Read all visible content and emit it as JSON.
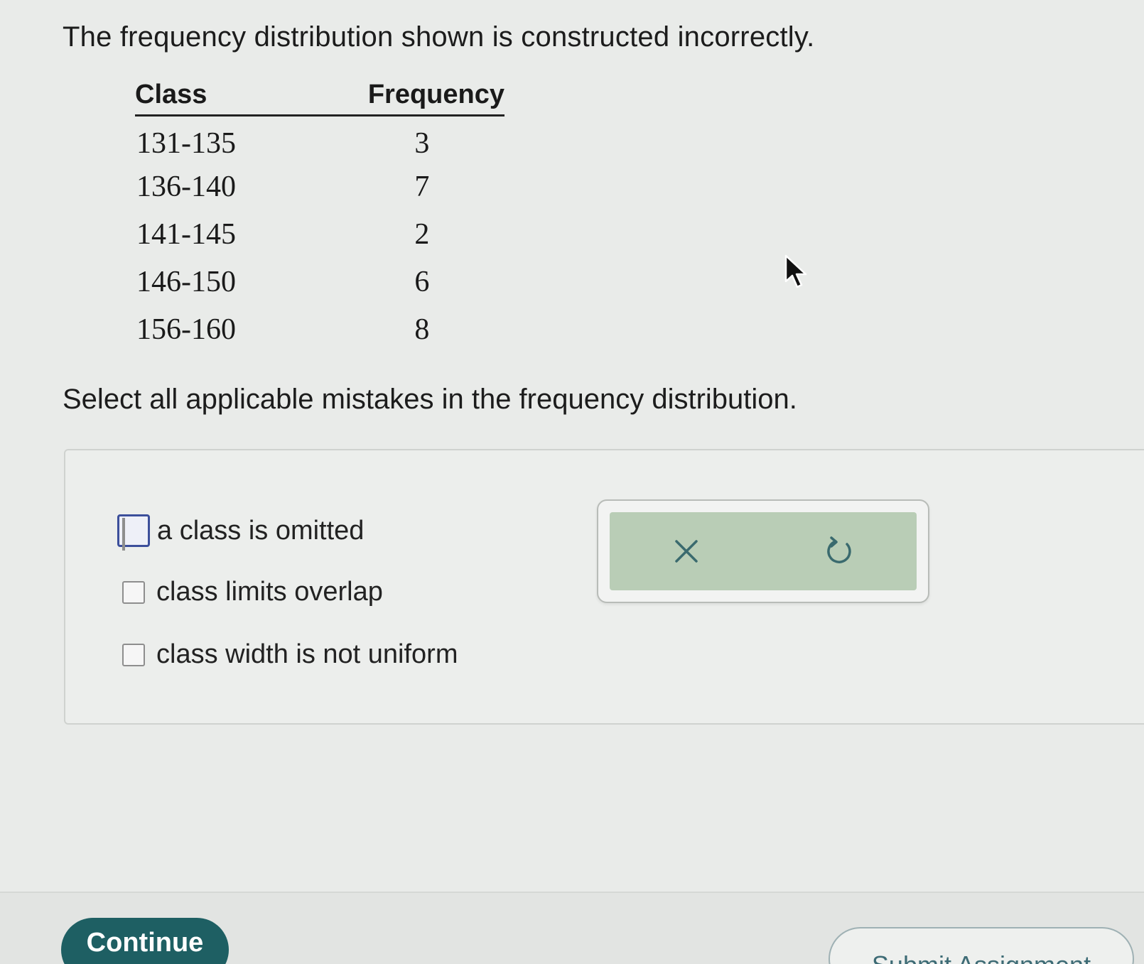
{
  "question": {
    "prompt": "The frequency distribution shown is constructed incorrectly.",
    "instruction": "Select all applicable mistakes in the frequency distribution."
  },
  "table": {
    "headers": {
      "class": "Class",
      "frequency": "Frequency"
    },
    "rows": [
      {
        "class": "131-135",
        "frequency": "3"
      },
      {
        "class": "136-140",
        "frequency": "7"
      },
      {
        "class": "141-145",
        "frequency": "2"
      },
      {
        "class": "146-150",
        "frequency": "6"
      },
      {
        "class": "156-160",
        "frequency": "8"
      }
    ]
  },
  "options": [
    {
      "label": "a class is omitted",
      "checked": false,
      "focused": true
    },
    {
      "label": "class limits overlap",
      "checked": false,
      "focused": false
    },
    {
      "label": "class width is not uniform",
      "checked": false,
      "focused": false
    }
  ],
  "actions": {
    "clear_icon": "close-icon",
    "reset_icon": "undo-icon"
  },
  "footer": {
    "continue_label": "Continue",
    "submit_label": "Submit Assignment"
  },
  "colors": {
    "continue_bg": "#1e5f63",
    "action_bar_bg": "#b9cdb6",
    "focus_ring": "#3c4f9b"
  }
}
